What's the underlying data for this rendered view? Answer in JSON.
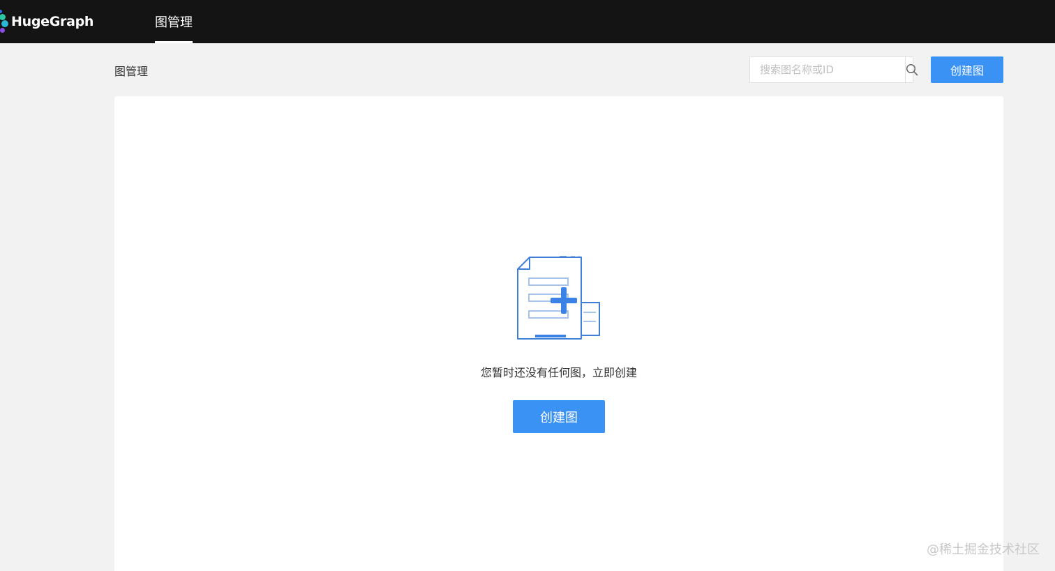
{
  "header": {
    "brand": "HugeGraph",
    "nav_tabs": [
      {
        "label": "图管理",
        "active": true
      }
    ]
  },
  "toolbar": {
    "page_title": "图管理",
    "search": {
      "placeholder": "搜索图名称或ID",
      "value": ""
    },
    "create_label": "创建图"
  },
  "empty_state": {
    "message": "您暂时还没有任何图，立即创建",
    "create_label": "创建图"
  },
  "watermark": "@稀土掘金技术社区",
  "colors": {
    "topbar_bg": "#141414",
    "page_bg": "#f2f2f2",
    "primary": "#3a92f4",
    "card_bg": "#ffffff"
  },
  "icons": {
    "search": "search-icon",
    "empty": "empty-document-add-icon",
    "logo": "hugegraph-logo-icon"
  }
}
